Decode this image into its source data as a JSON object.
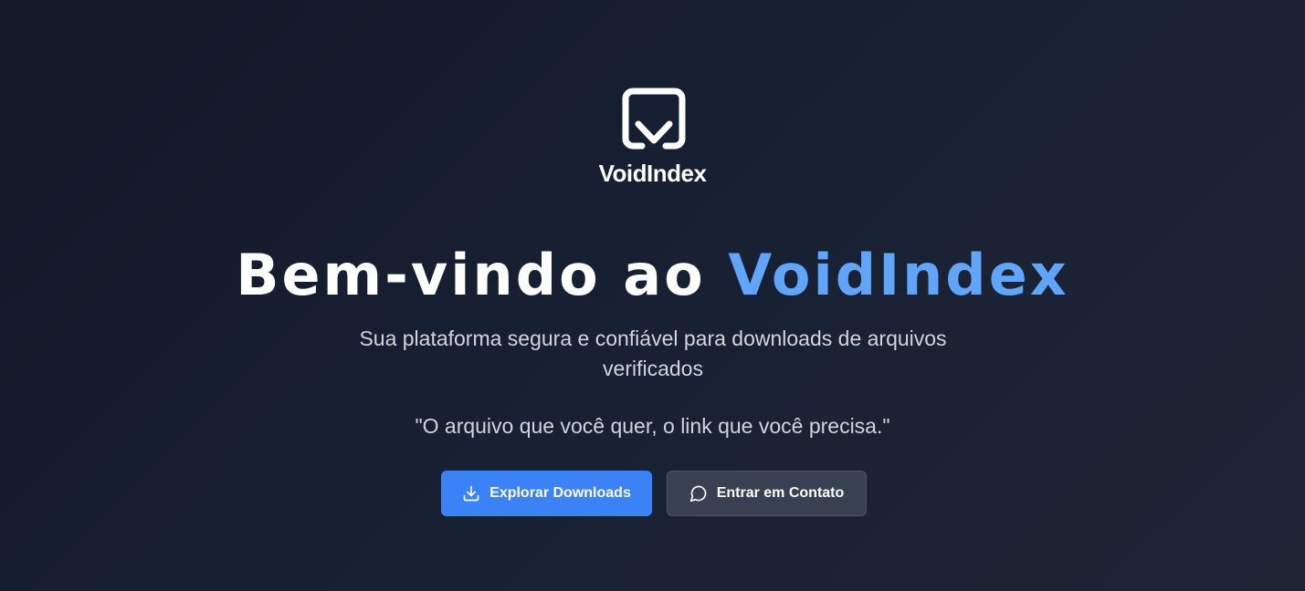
{
  "brand": {
    "name": "VoidIndex",
    "logo_icon": "voidindex-logo-icon"
  },
  "hero": {
    "title_prefix": "Bem-vindo ao ",
    "title_accent": "VoidIndex",
    "subtitle": "Sua plataforma segura e confiável para downloads de arquivos verificados",
    "quote": "\"O arquivo que você quer, o link que você precisa.\""
  },
  "actions": {
    "primary": {
      "label": "Explorar Downloads",
      "icon": "download-icon"
    },
    "secondary": {
      "label": "Entrar em Contato",
      "icon": "message-circle-icon"
    }
  },
  "colors": {
    "background": "#111827",
    "accent": "#60a5fa",
    "primary_button": "#3b82f6",
    "secondary_button": "#374151",
    "text_muted": "#d1d5db"
  }
}
